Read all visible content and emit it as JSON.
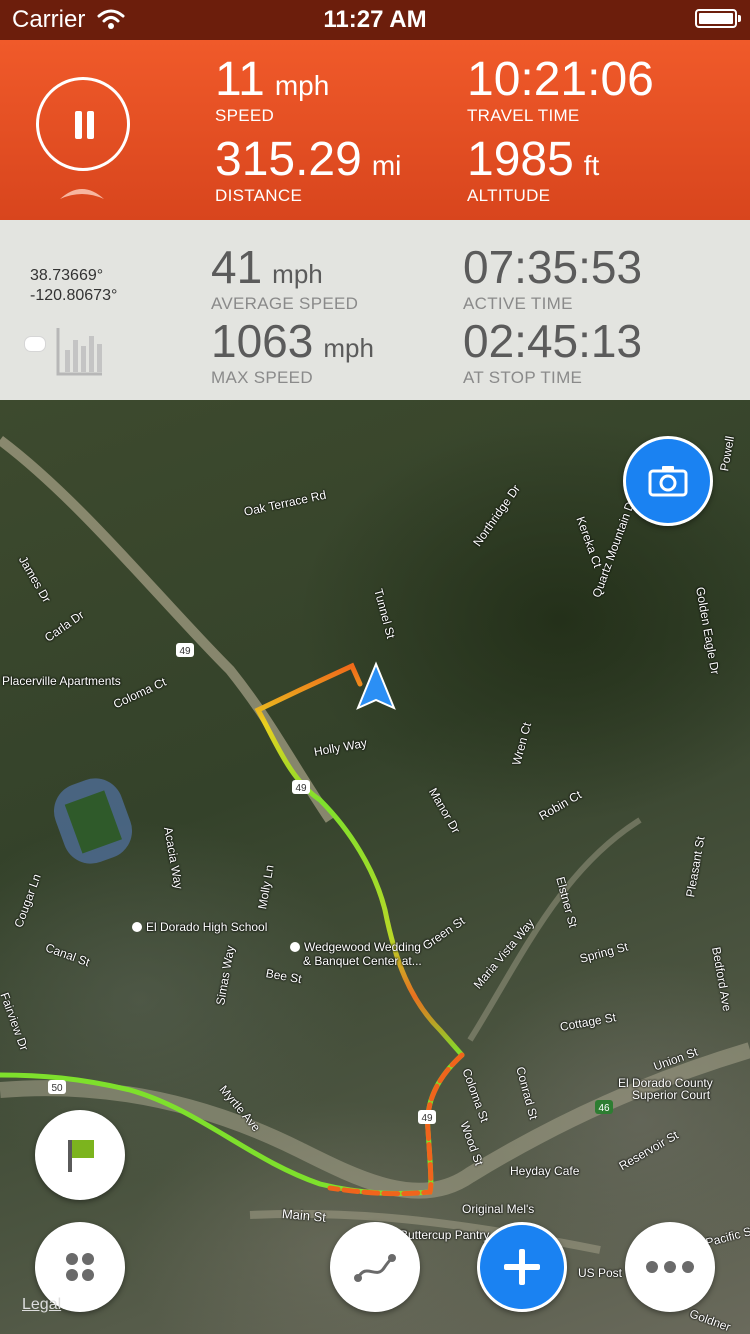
{
  "status_bar": {
    "carrier": "Carrier",
    "time": "11:27 AM"
  },
  "stats_top": {
    "speed": {
      "value": "11",
      "unit": "mph",
      "label": "SPEED"
    },
    "travel_time": {
      "value": "10:21:06",
      "unit": "",
      "label": "TRAVEL TIME"
    },
    "distance": {
      "value": "315.29",
      "unit": "mi",
      "label": "DISTANCE"
    },
    "altitude": {
      "value": "1985",
      "unit": "ft",
      "label": "ALTITUDE"
    }
  },
  "stats_mid": {
    "latitude": "38.73669°",
    "longitude": "-120.80673°",
    "average_speed": {
      "value": "41",
      "unit": "mph",
      "label": "AVERAGE SPEED"
    },
    "active_time": {
      "value": "07:35:53",
      "unit": "",
      "label": "ACTIVE TIME"
    },
    "max_speed": {
      "value": "1063",
      "unit": "mph",
      "label": "MAX SPEED"
    },
    "at_stop_time": {
      "value": "02:45:13",
      "unit": "",
      "label": "AT STOP TIME"
    }
  },
  "map": {
    "streets": [
      "Oak Terrace Rd",
      "Northridge Dr",
      "Tunnel St",
      "James Dr",
      "Carla Dr",
      "Placerville Apartments",
      "Coloma Ct",
      "Holly Way",
      "Manor Dr",
      "Wren Ct",
      "Robin Ct",
      "Acacia Way",
      "Cougar Ln",
      "El Dorado High School",
      "Canal St",
      "Molly Ln",
      "Wedgewood Wedding",
      "& Banquet Center at...",
      "Bee St",
      "Green St",
      "Maria Vista Way",
      "Spring St",
      "Elstner St",
      "Pleasant St",
      "Bedford Ave",
      "Fairview Dr",
      "Simas Way",
      "Myrtle Ave",
      "Cottage St",
      "Conrad St",
      "Coloma St",
      "Wood St",
      "Union St",
      "El Dorado County",
      "Superior Court",
      "Heyday Cafe",
      "Reservoir St",
      "Main St",
      "Original Mel's",
      "Buttercup Pantry",
      "US Post O",
      "Kereka Ct",
      "Quartz Mountain Dr",
      "Golden Eagle Dr",
      "Powell",
      "Goldner",
      "Pacific St",
      "49",
      "49",
      "49",
      "50",
      "46"
    ],
    "legal_label": "Legal"
  },
  "icons": {
    "pause": "pause-icon",
    "chevron": "chevron-up-icon",
    "chart": "bar-chart-icon",
    "camera": "camera-icon",
    "flag": "flag-icon",
    "grid": "grid-icon",
    "route": "route-icon",
    "add": "plus-icon",
    "more": "more-icon",
    "location": "location-arrow-icon"
  },
  "colors": {
    "accent": "#e8522a",
    "status_bar": "#6c1e0c",
    "button_blue": "#1a82f2",
    "flag_green": "#7cb41e"
  }
}
